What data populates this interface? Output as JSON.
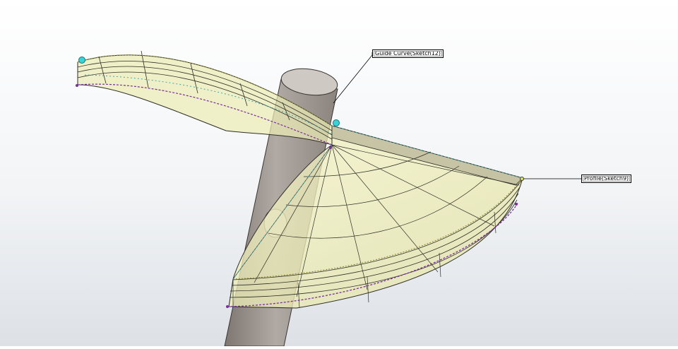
{
  "viewport": {
    "background_top": "#ffffff",
    "background_bottom": "#dfe3e8"
  },
  "callouts": {
    "guide_curve": "Guide Curve(Sketch12)",
    "profile": "Profile(Sketch9)"
  },
  "colors": {
    "surface_fill": "#ecebb4",
    "surface_edge": "#2e2e28",
    "shaft_fill": "#a39c97",
    "guide_curve": "#4a3a9a",
    "profile_curve": "#7a2ea0",
    "handle_point": "#38d3d8",
    "preview_dotted": "#8c8630",
    "edge_dotted": "#3fa9b0"
  }
}
